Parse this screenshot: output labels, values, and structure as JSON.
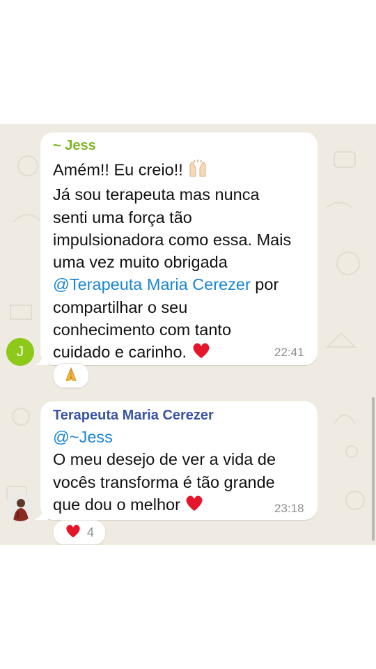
{
  "messages": [
    {
      "sender": "~ Jess",
      "avatar_initial": "J",
      "avatar_color": "#8cc919",
      "text_part1": "Amém!! Eu creio!! ",
      "text_part2": "\nJá sou terapeuta mas nunca\nsenti uma força tão\nimpulsionadora como essa. Mais\numa vez muito obrigada\n",
      "mention": "@Terapeuta Maria Cerezer",
      "text_part3": " por\ncompartilhar o seu\nconhecimento com tanto\ncuidado e carinho. ",
      "time": "22:41",
      "reaction": {
        "icon": "folded-hands-icon",
        "count": ""
      }
    },
    {
      "sender": "Terapeuta Maria Cerezer",
      "sender_color": "#3a53a4",
      "mention": "@~Jess",
      "text": "\nO meu desejo de ver a vida de\nvocês transforma é tão grande\nque dou o melhor ",
      "time": "23:18",
      "reaction": {
        "icon": "heart-icon",
        "count": "4"
      }
    }
  ],
  "colors": {
    "chat_background": "#efeae2",
    "bubble": "#ffffff",
    "mention": "#1a86d6",
    "timestamp": "#8d8d8d"
  }
}
